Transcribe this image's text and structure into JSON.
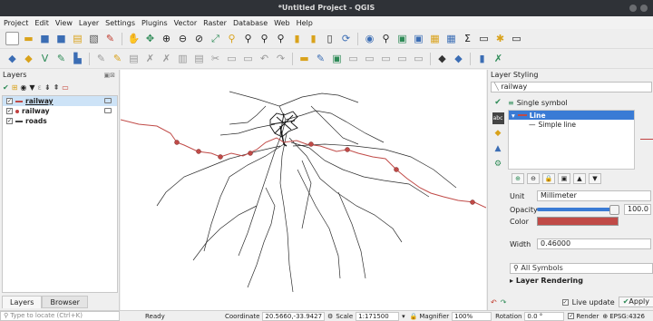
{
  "window": {
    "title": "*Untitled Project - QGIS"
  },
  "menu": [
    "Project",
    "Edit",
    "View",
    "Layer",
    "Settings",
    "Plugins",
    "Vector",
    "Raster",
    "Database",
    "Web",
    "Help"
  ],
  "colors": {
    "accent": "#3a7bd5",
    "railway": "#c04a47",
    "map_bg": "#ffffff",
    "roads": "#2b2b2b"
  },
  "layers_panel": {
    "title": "Layers",
    "layers": [
      {
        "name": "railway",
        "checked": true,
        "selected": true
      },
      {
        "name": "railway",
        "checked": true,
        "selected": false
      },
      {
        "name": "roads",
        "checked": true,
        "selected": false
      }
    ],
    "tabs": [
      "Layers",
      "Browser"
    ]
  },
  "styling": {
    "title": "Layer Styling",
    "layer": "railway",
    "renderer": "Single symbol",
    "tree_root": "Line",
    "tree_child": "Simple line",
    "unit_label": "Unit",
    "unit_value": "Millimeter",
    "opacity_label": "Opacity",
    "opacity_value": "100.0",
    "color_label": "Color",
    "width_label": "Width",
    "width_value": "0.46000",
    "search_placeholder": "All Symbols",
    "rendering_label": "Layer Rendering",
    "live_update": "Live update",
    "apply": "Apply"
  },
  "status": {
    "locate_placeholder": "Type to locate (Ctrl+K)",
    "ready": "Ready",
    "coordinate_label": "Coordinate",
    "coordinate": "20.5660,-33.9427",
    "scale_label": "Scale",
    "scale": "1:171500",
    "magnifier_label": "Magnifier",
    "magnifier": "100%",
    "rotation_label": "Rotation",
    "rotation": "0.0 °",
    "render_label": "Render",
    "crs": "EPSG:4326"
  }
}
